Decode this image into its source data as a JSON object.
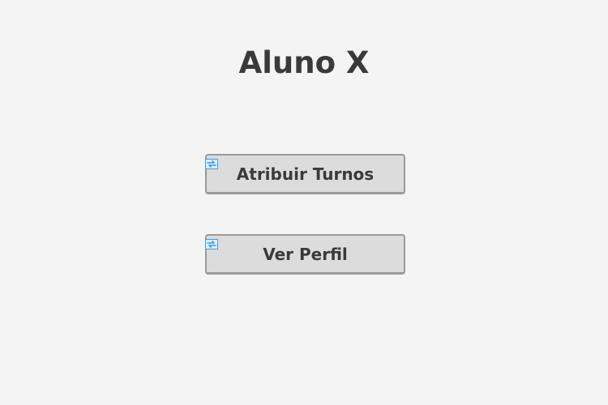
{
  "page": {
    "title": "Aluno X"
  },
  "actions": [
    {
      "label": "Atribuir Turnos",
      "icon": "refresh-icon"
    },
    {
      "label": "Ver Perfil",
      "icon": "refresh-icon"
    }
  ],
  "colors": {
    "background": "#f4f4f4",
    "button_bg": "#dcdcdc",
    "button_border": "#9a9a9a",
    "text": "#3a3a3a",
    "icon_accent": "#3d9be3"
  }
}
